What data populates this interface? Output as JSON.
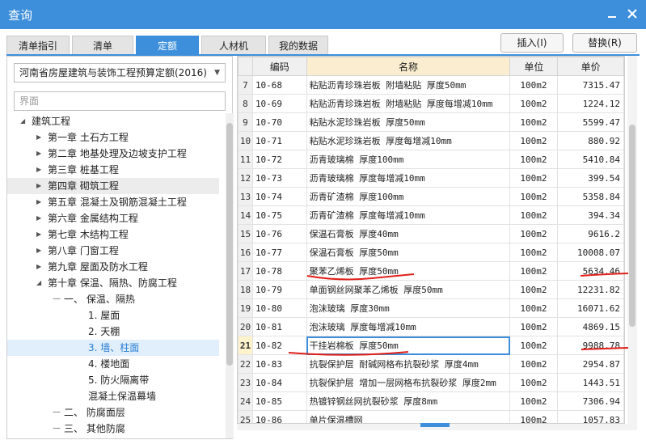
{
  "window": {
    "title": "查询"
  },
  "tabs": [
    {
      "label": "清单指引",
      "active": false
    },
    {
      "label": "清单",
      "active": false
    },
    {
      "label": "定额",
      "active": true
    },
    {
      "label": "人材机",
      "active": false
    },
    {
      "label": "我的数据",
      "active": false
    }
  ],
  "actions": {
    "insert_label": "插入(I)",
    "replace_label": "替换(R)"
  },
  "left": {
    "quota_select": "河南省房屋建筑与装饰工程预算定额(2016)",
    "search_placeholder": "界面",
    "tree": [
      {
        "label": "建筑工程",
        "level": 0,
        "expanded": true
      },
      {
        "label": "第一章 土石方工程",
        "level": 1
      },
      {
        "label": "第二章 地基处理及边坡支护工程",
        "level": 1
      },
      {
        "label": "第三章 桩基工程",
        "level": 1
      },
      {
        "label": "第四章 砌筑工程",
        "level": 1,
        "hover": true
      },
      {
        "label": "第五章 混凝土及钢筋混凝土工程",
        "level": 1
      },
      {
        "label": "第六章 金属结构工程",
        "level": 1
      },
      {
        "label": "第七章 木结构工程",
        "level": 1
      },
      {
        "label": "第八章 门窗工程",
        "level": 1
      },
      {
        "label": "第九章 屋面及防水工程",
        "level": 1
      },
      {
        "label": "第十章 保温、隔热、防腐工程",
        "level": 1,
        "expanded": true
      },
      {
        "label": "一、 保温、隔热",
        "level": 2,
        "expanded": true
      },
      {
        "label": "1. 屋面",
        "level": 3
      },
      {
        "label": "2. 天棚",
        "level": 3
      },
      {
        "label": "3. 墙、柱面",
        "level": 3,
        "selected": true
      },
      {
        "label": "4. 楼地面",
        "level": 3
      },
      {
        "label": "5. 防火隔离带",
        "level": 3
      },
      {
        "label": "混凝土保温幕墙",
        "level": 3
      },
      {
        "label": "二、 防腐面层",
        "level": 2
      },
      {
        "label": "三、 其他防腐",
        "level": 2
      }
    ]
  },
  "table": {
    "headers": {
      "code": "编码",
      "name": "名称",
      "unit": "单位",
      "price": "单价"
    },
    "rows": [
      {
        "n": "7",
        "code": "10-68",
        "name": "粘贴沥青珍珠岩板 附墙粘贴 厚度50mm",
        "unit": "100m2",
        "price": "7315.47"
      },
      {
        "n": "8",
        "code": "10-69",
        "name": "粘贴沥青珍珠岩板 附墙粘贴 厚度每增减10mm",
        "unit": "100m2",
        "price": "1224.12"
      },
      {
        "n": "9",
        "code": "10-70",
        "name": "粘贴水泥珍珠岩板 厚度50mm",
        "unit": "100m2",
        "price": "5599.47"
      },
      {
        "n": "10",
        "code": "10-71",
        "name": "粘贴水泥珍珠岩板 厚度每增减10mm",
        "unit": "100m2",
        "price": "880.92"
      },
      {
        "n": "11",
        "code": "10-72",
        "name": "沥青玻璃棉 厚度100mm",
        "unit": "100m2",
        "price": "5410.84"
      },
      {
        "n": "12",
        "code": "10-73",
        "name": "沥青玻璃棉 厚度每增减10mm",
        "unit": "100m2",
        "price": "399.54"
      },
      {
        "n": "13",
        "code": "10-74",
        "name": "沥青矿渣棉 厚度100mm",
        "unit": "100m2",
        "price": "5358.84"
      },
      {
        "n": "14",
        "code": "10-75",
        "name": "沥青矿渣棉 厚度每增减10mm",
        "unit": "100m2",
        "price": "394.34"
      },
      {
        "n": "15",
        "code": "10-76",
        "name": "保温石膏板 厚度40mm",
        "unit": "100m2",
        "price": "9616.2"
      },
      {
        "n": "16",
        "code": "10-77",
        "name": "保温石膏板 厚度50mm",
        "unit": "100m2",
        "price": "10008.07"
      },
      {
        "n": "17",
        "code": "10-78",
        "name": "聚苯乙烯板 厚度50mm",
        "unit": "100m2",
        "price": "5634.46"
      },
      {
        "n": "18",
        "code": "10-79",
        "name": "单面钢丝网聚苯乙烯板 厚度50mm",
        "unit": "100m2",
        "price": "12231.82"
      },
      {
        "n": "19",
        "code": "10-80",
        "name": "泡沫玻璃 厚度30mm",
        "unit": "100m2",
        "price": "16071.62"
      },
      {
        "n": "20",
        "code": "10-81",
        "name": "泡沫玻璃 厚度每增减10mm",
        "unit": "100m2",
        "price": "4869.15"
      },
      {
        "n": "21",
        "code": "10-82",
        "name": "干挂岩棉板 厚度50mm",
        "unit": "100m2",
        "price": "9988.78",
        "current": true
      },
      {
        "n": "22",
        "code": "10-83",
        "name": "抗裂保护层 耐碱网格布抗裂砂浆 厚度4mm",
        "unit": "100m2",
        "price": "2954.87"
      },
      {
        "n": "23",
        "code": "10-84",
        "name": "抗裂保护层 增加一层网格布抗裂砂浆 厚度2mm",
        "unit": "100m2",
        "price": "1443.51"
      },
      {
        "n": "24",
        "code": "10-85",
        "name": "热镀锌钢丝网抗裂砂浆 厚度8mm",
        "unit": "100m2",
        "price": "7306.94"
      },
      {
        "n": "25",
        "code": "10-86",
        "name": "单片保温槽网",
        "unit": "100m2",
        "price": "1057.83"
      }
    ]
  },
  "annotation_color": "#e0201a"
}
